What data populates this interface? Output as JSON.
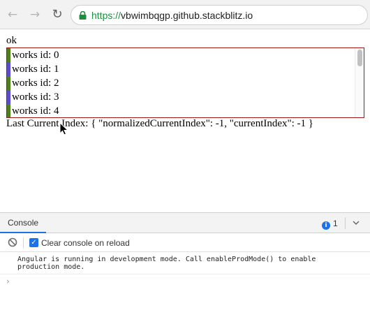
{
  "browser": {
    "url_scheme": "https://",
    "url_host": "vbwimbqgp.github.stackblitz.io"
  },
  "page": {
    "status": "ok",
    "list_items": [
      {
        "label": "works id: 0",
        "color": "#4e7f1a"
      },
      {
        "label": "works id: 1",
        "color": "#5a4bd1"
      },
      {
        "label": "works id: 2",
        "color": "#4e7f1a"
      },
      {
        "label": "works id: 3",
        "color": "#5a4bd1"
      },
      {
        "label": "works id: 4",
        "color": "#4e7f1a"
      }
    ],
    "index_text": "Last Current Index: { \"normalizedCurrentIndex\": -1, \"currentIndex\": -1 }"
  },
  "console": {
    "tab_label": "Console",
    "issues_count": "1",
    "clear_label": "Clear console on reload",
    "clear_checked": true,
    "message": "Angular is running in development mode. Call enableProdMode() to enable\nproduction mode.",
    "prompt": "›"
  }
}
